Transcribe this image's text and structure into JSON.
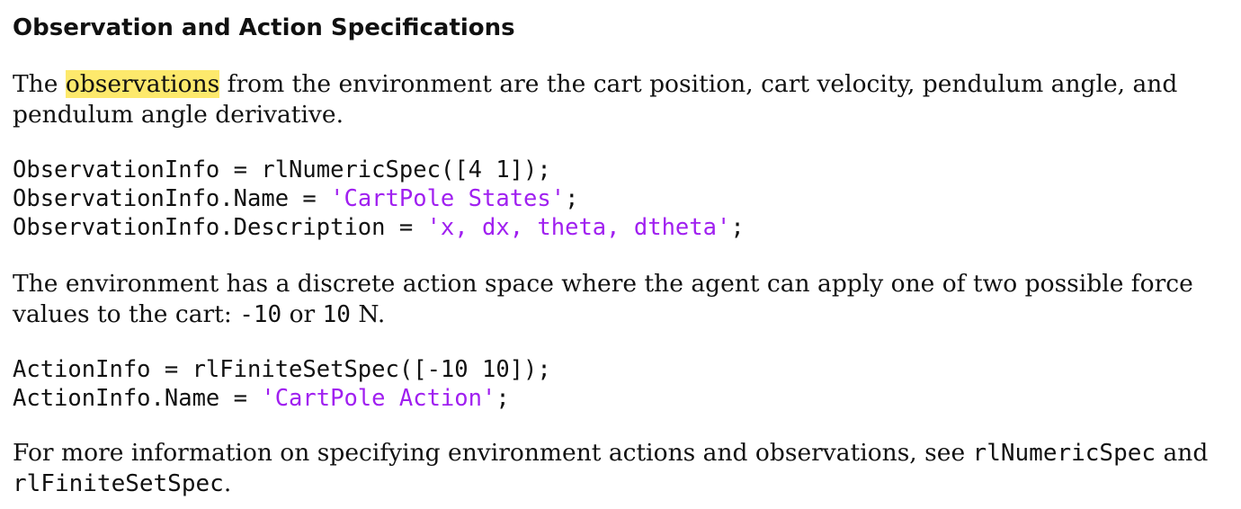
{
  "heading": "Observation and Action Specifications",
  "para1": {
    "before": "The ",
    "highlight": "observations",
    "after": " from the environment are the cart position, cart velocity, pendulum angle, and pendulum angle derivative."
  },
  "code1": {
    "line1": "ObservationInfo = rlNumericSpec([4 1]);",
    "line2_pre": "ObservationInfo.Name = ",
    "line2_str": "'CartPole States'",
    "line2_post": ";",
    "line3_pre": "ObservationInfo.Description = ",
    "line3_str": "'x, dx, theta, dtheta'",
    "line3_post": ";"
  },
  "para2": {
    "text1": "The environment has a discrete action space where the agent can apply one of two possible force values to the cart: ",
    "code1": "-10",
    "text2": " or ",
    "code2": "10",
    "text3": " N."
  },
  "code2": {
    "line1": "ActionInfo = rlFiniteSetSpec([-10 10]);",
    "line2_pre": "ActionInfo.Name = ",
    "line2_str": "'CartPole Action'",
    "line2_post": ";"
  },
  "para3": {
    "text1": "For more information on specifying environment actions and observations, see ",
    "link1": "rlNumericSpec",
    "text2": " and ",
    "link2": "rlFiniteSetSpec",
    "text3": "."
  },
  "colors": {
    "highlight": "#fde96c",
    "string": "#a020f0",
    "text": "#111111"
  }
}
